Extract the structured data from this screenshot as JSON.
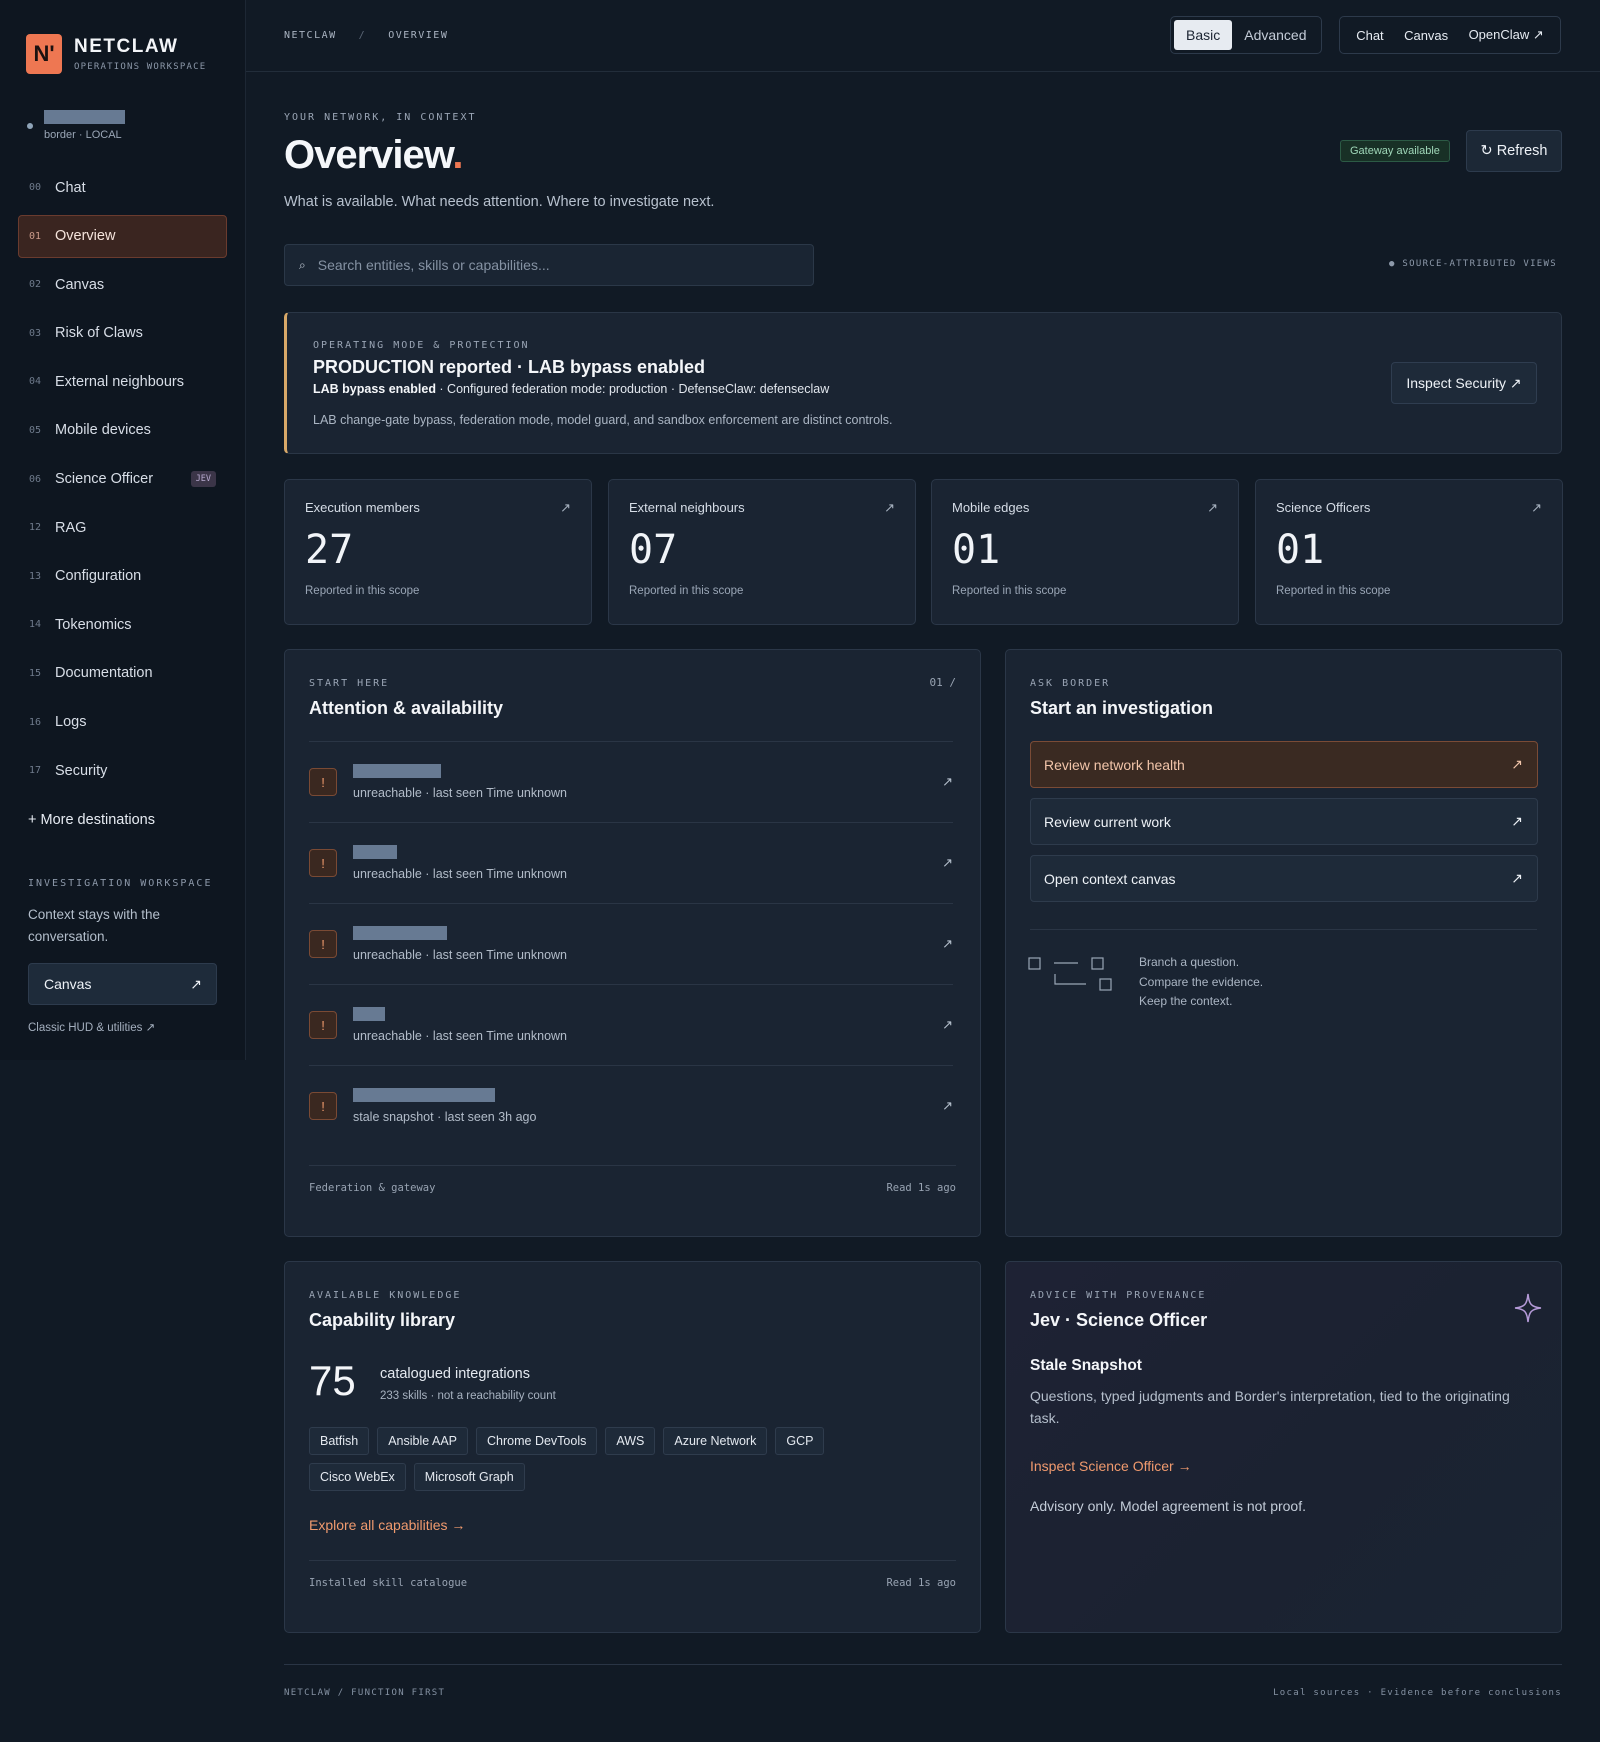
{
  "brand": {
    "logo": "N'",
    "name": "NETCLAW",
    "subtitle": "OPERATIONS WORKSPACE"
  },
  "host": {
    "context": "border · LOCAL"
  },
  "sidebar": {
    "items": [
      {
        "num": "00",
        "label": "Chat"
      },
      {
        "num": "01",
        "label": "Overview",
        "active": true
      },
      {
        "num": "02",
        "label": "Canvas"
      },
      {
        "num": "03",
        "label": "Risk of Claws"
      },
      {
        "num": "04",
        "label": "External neighbours"
      },
      {
        "num": "05",
        "label": "Mobile devices"
      },
      {
        "num": "06",
        "label": "Science Officer",
        "badge": "JEV"
      },
      {
        "num": "12",
        "label": "RAG"
      },
      {
        "num": "13",
        "label": "Configuration"
      },
      {
        "num": "14",
        "label": "Tokenomics"
      },
      {
        "num": "15",
        "label": "Documentation"
      },
      {
        "num": "16",
        "label": "Logs"
      },
      {
        "num": "17",
        "label": "Security"
      }
    ],
    "more": "+ More destinations",
    "workspace_title": "INVESTIGATION WORKSPACE",
    "workspace_desc": "Context stays with the conversation.",
    "workspace_button": "Canvas",
    "workspace_button_icon": "↗",
    "classic_link": "Classic HUD & utilities ↗"
  },
  "topbar": {
    "breadcrumb": [
      "NETCLAW",
      "/",
      "OVERVIEW"
    ],
    "mode_options": [
      "Basic",
      "Advanced"
    ],
    "mode_selected": "Basic",
    "links": [
      "Chat",
      "Canvas",
      "OpenClaw ↗"
    ]
  },
  "hero": {
    "eyebrow": "YOUR NETWORK, IN CONTEXT",
    "title": "Overview",
    "title_dot": ".",
    "subtitle": "What is available. What needs attention. Where to investigate next.",
    "gateway_badge": "Gateway available",
    "refresh_label": "↻ Refresh"
  },
  "search": {
    "placeholder": "Search entities, skills or capabilities...",
    "icon": "⌕",
    "source_note": "● SOURCE-ATTRIBUTED VIEWS"
  },
  "mode_card": {
    "eyebrow": "OPERATING MODE & PROTECTION",
    "title": "PRODUCTION reported · LAB bypass enabled",
    "detail_bold": "LAB bypass enabled",
    "detail_rest": " · Configured federation mode: production · DefenseClaw: defenseclaw",
    "note": "LAB change-gate bypass, federation mode, model guard, and sandbox enforcement are distinct controls.",
    "button": "Inspect Security ↗",
    "accent_color": "#d8a868"
  },
  "stats": [
    {
      "label": "Execution members",
      "value": "27",
      "foot": "Reported in this scope",
      "arrow": "↗"
    },
    {
      "label": "External neighbours",
      "value": "07",
      "foot": "Reported in this scope",
      "arrow": "↗"
    },
    {
      "label": "Mobile edges",
      "value": "01",
      "foot": "Reported in this scope",
      "arrow": "↗"
    },
    {
      "label": "Science Officers",
      "value": "01",
      "foot": "Reported in this scope",
      "arrow": "↗"
    }
  ],
  "attention": {
    "eyebrow": "START HERE",
    "title": "Attention & availability",
    "count": "01 /",
    "rows": [
      {
        "status": "unreachable · last seen Time unknown"
      },
      {
        "status": "unreachable · last seen Time unknown"
      },
      {
        "status": "unreachable · last seen Time unknown"
      },
      {
        "status": "unreachable · last seen Time unknown"
      },
      {
        "status": "stale snapshot · last seen 3h ago"
      }
    ],
    "footer_left": "Federation & gateway",
    "footer_right": "Read 1s ago"
  },
  "investigate": {
    "eyebrow": "ASK BORDER",
    "title": "Start an investigation",
    "actions": [
      {
        "label": "Review network health",
        "arrow": "↗"
      },
      {
        "label": "Review current work",
        "arrow": "↗"
      },
      {
        "label": "Open context canvas",
        "arrow": "↗"
      }
    ],
    "tagline": [
      "Branch a question.",
      "Compare the evidence.",
      "Keep the context."
    ]
  },
  "capabilities": {
    "eyebrow": "AVAILABLE KNOWLEDGE",
    "title": "Capability library",
    "count": "75",
    "count_label": "catalogued integrations",
    "count_sub": "233 skills · not a reachability count",
    "chips": [
      "Batfish",
      "Ansible AAP",
      "Chrome DevTools",
      "AWS",
      "Azure Network",
      "GCP",
      "Cisco WebEx",
      "Microsoft Graph"
    ],
    "link": "Explore all capabilities →",
    "footer_left": "Installed skill catalogue",
    "footer_right": "Read 1s ago"
  },
  "advice": {
    "eyebrow": "ADVICE WITH PROVENANCE",
    "title": "Jev · Science Officer",
    "subtitle": "Stale Snapshot",
    "description": "Questions, typed judgments and Border's interpretation, tied to the originating task.",
    "link": "Inspect Science Officer →",
    "note": "Advisory only. Model agreement is not proof."
  },
  "footer": {
    "left": "NETCLAW / FUNCTION FIRST",
    "right": "Local sources · Evidence before conclusions"
  },
  "colors": {
    "accent": "#ee7752",
    "background": "#111a25",
    "panel": "#1a2432",
    "warning": "#d8a868",
    "success": "#9fd6b8"
  }
}
